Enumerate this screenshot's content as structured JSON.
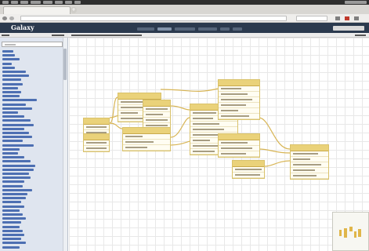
{
  "app": {
    "title": "Galaxy",
    "brand_color": "#2b3a4e",
    "accent_color": "#ead27a"
  },
  "toolbar": {
    "new_tab_icon": "plus-icon"
  },
  "nodes": [
    {
      "id": "n1",
      "rows": 4
    },
    {
      "id": "n2",
      "rows": 4
    },
    {
      "id": "n3",
      "rows": 3
    },
    {
      "id": "n4",
      "rows": 2
    },
    {
      "id": "n5",
      "rows": 2
    },
    {
      "id": "n6",
      "rows": 8
    },
    {
      "id": "n7",
      "rows": 6
    },
    {
      "id": "n8",
      "rows": 3
    },
    {
      "id": "n9",
      "rows": 2
    },
    {
      "id": "n10",
      "rows": 5
    }
  ],
  "sidebar_item_count": 49
}
